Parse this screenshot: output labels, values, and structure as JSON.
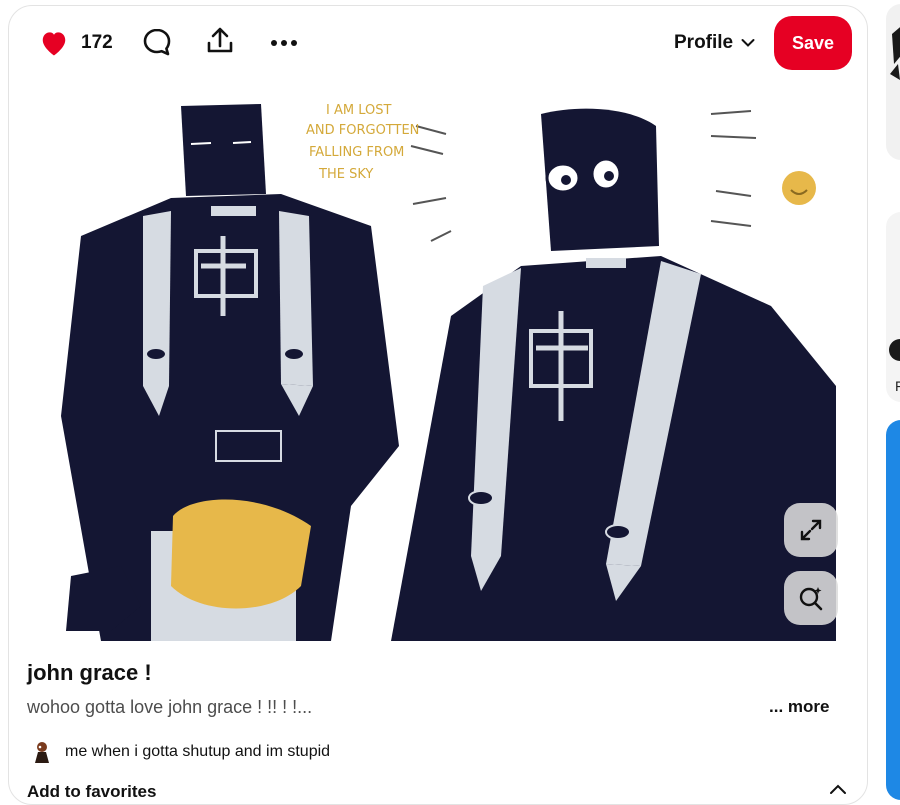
{
  "actions": {
    "like_count": "172",
    "profile_label": "Profile",
    "save_label": "Save"
  },
  "pin": {
    "artwork_text": [
      "I AM LOST",
      "AND FORGOTTEN",
      "FALLING FROM",
      "THE SKY"
    ],
    "title": "john grace !",
    "description": "wohoo gotta love john grace ! !! ! !...",
    "more_label": "... more",
    "author_name": "me when i gotta shutup and im stupid",
    "favorites_label": "Add to favorites"
  },
  "side": {
    "cropped_text": "F"
  },
  "colors": {
    "save": "#e60023",
    "heart": "#e60023",
    "robe": "#141633",
    "gold": "#e7b84a",
    "sidebar_blue": "#1e88e5"
  },
  "icons": [
    "heart-icon",
    "comment-icon",
    "share-icon",
    "more-icon",
    "chevron-down-icon",
    "expand-icon",
    "visual-search-icon",
    "chevron-up-icon"
  ]
}
